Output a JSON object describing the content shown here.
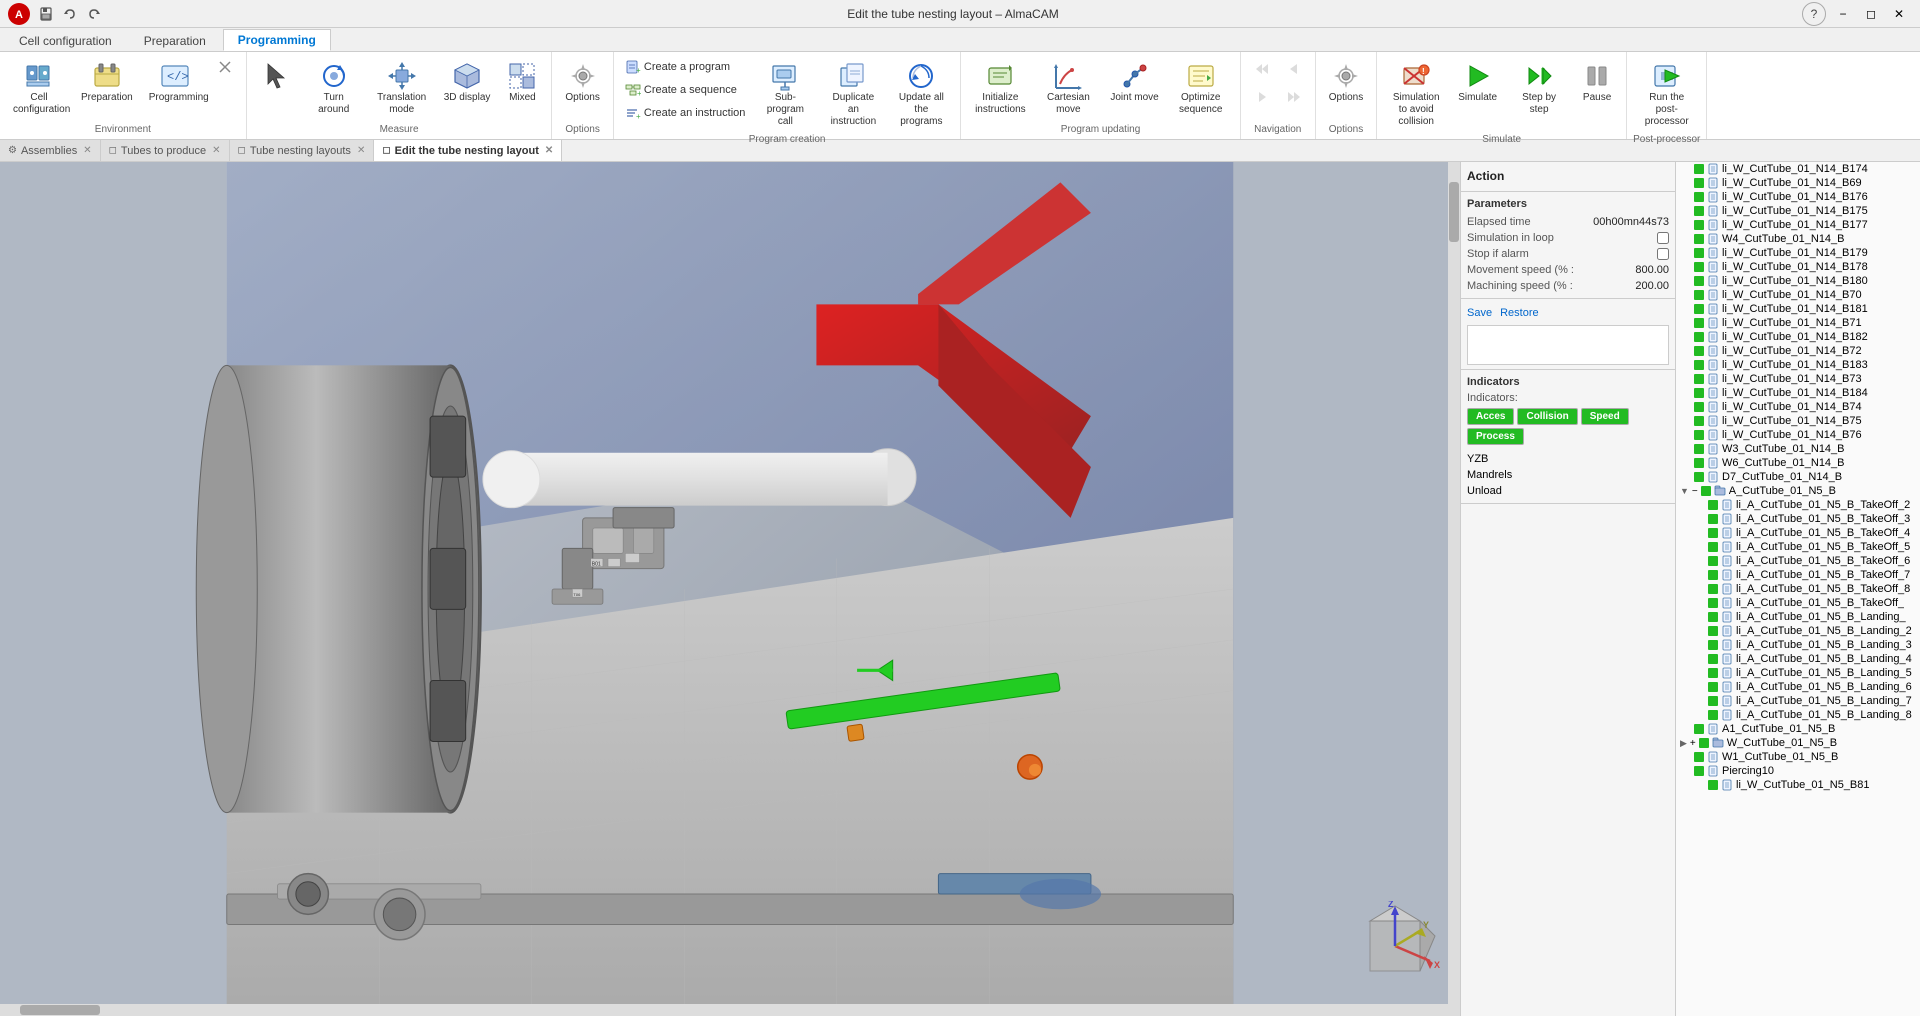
{
  "titlebar": {
    "title": "Edit the tube nesting layout – AlmaCAM",
    "logo_text": "A",
    "quick_actions": [
      "save",
      "undo",
      "redo"
    ],
    "win_buttons": [
      "minimize",
      "restore",
      "close"
    ]
  },
  "ribbon_tabs": [
    {
      "label": "Cell configuration",
      "active": false
    },
    {
      "label": "Preparation",
      "active": false
    },
    {
      "label": "Programming",
      "active": true
    }
  ],
  "ribbon_groups": [
    {
      "id": "environment",
      "label": "Environment",
      "buttons": [
        {
          "id": "cell-config",
          "label": "Cell configuration",
          "icon": "cell"
        },
        {
          "id": "preparation",
          "label": "Preparation",
          "icon": "prep"
        },
        {
          "id": "programming",
          "label": "Programming",
          "icon": "prog"
        }
      ]
    },
    {
      "id": "measure",
      "label": "Measure",
      "buttons": [
        {
          "id": "measure-cursor",
          "label": "",
          "icon": "cursor"
        },
        {
          "id": "turn-around",
          "label": "Turn around",
          "icon": "rotate"
        },
        {
          "id": "translation",
          "label": "Translation mode",
          "icon": "translate"
        },
        {
          "id": "3d-display",
          "label": "3D display",
          "icon": "3d"
        },
        {
          "id": "mixed",
          "label": "Mixed",
          "icon": "mixed"
        }
      ]
    },
    {
      "id": "options-left",
      "label": "Options",
      "buttons": [
        {
          "id": "options",
          "label": "Options",
          "icon": "options"
        }
      ]
    },
    {
      "id": "program-creation",
      "label": "Program creation",
      "buttons": [
        {
          "id": "create-program",
          "label": "Create a program",
          "icon": "create-prog",
          "small": true
        },
        {
          "id": "create-sequence",
          "label": "Create a sequence",
          "icon": "create-seq",
          "small": true
        },
        {
          "id": "create-instruction",
          "label": "Create an instruction",
          "icon": "create-instr",
          "small": true
        },
        {
          "id": "sub-program",
          "label": "Sub-program call",
          "icon": "sub-prog"
        },
        {
          "id": "duplicate",
          "label": "Duplicate an instruction",
          "icon": "duplicate"
        },
        {
          "id": "update-all",
          "label": "Update all the programs",
          "icon": "update"
        }
      ]
    },
    {
      "id": "program-updating",
      "label": "Program updating",
      "buttons": [
        {
          "id": "initialize",
          "label": "Initialize instructions",
          "icon": "init"
        },
        {
          "id": "cartesian-move",
          "label": "Cartesian move",
          "icon": "cart-move"
        },
        {
          "id": "joint-move",
          "label": "Joint move",
          "icon": "joint-move"
        },
        {
          "id": "optimize",
          "label": "Optimize sequence",
          "icon": "optimize"
        }
      ]
    },
    {
      "id": "navigation",
      "label": "Navigation",
      "buttons": [
        {
          "id": "nav-prev-prev",
          "label": "",
          "icon": "nav-prev-prev"
        },
        {
          "id": "nav-prev",
          "label": "",
          "icon": "nav-prev"
        },
        {
          "id": "nav-next",
          "label": "",
          "icon": "nav-next"
        },
        {
          "id": "nav-next-next",
          "label": "",
          "icon": "nav-next-next"
        }
      ]
    },
    {
      "id": "options-right",
      "label": "Options",
      "buttons": [
        {
          "id": "options2",
          "label": "Options",
          "icon": "options2"
        }
      ]
    },
    {
      "id": "simulate-group",
      "label": "Simulate",
      "buttons": [
        {
          "id": "sim-avoid",
          "label": "Simulation to avoid collision",
          "icon": "sim-avoid"
        },
        {
          "id": "simulate",
          "label": "Simulate",
          "icon": "simulate"
        },
        {
          "id": "step-by-step",
          "label": "Step by step",
          "icon": "step"
        },
        {
          "id": "pause",
          "label": "Pause",
          "icon": "pause"
        }
      ]
    },
    {
      "id": "post-processor",
      "label": "Post-processor",
      "buttons": [
        {
          "id": "run-post",
          "label": "Run the post-processor",
          "icon": "run-post"
        }
      ]
    }
  ],
  "doc_tabs": [
    {
      "label": "Assemblies",
      "icon": "assembly",
      "active": false,
      "closable": true
    },
    {
      "label": "Tubes to produce",
      "icon": "tubes",
      "active": false,
      "closable": true
    },
    {
      "label": "Tube nesting layouts",
      "icon": "layouts",
      "active": false,
      "closable": true
    },
    {
      "label": "Edit the tube nesting layout",
      "icon": "edit",
      "active": true,
      "closable": true
    }
  ],
  "action_panel": {
    "title": "Action",
    "parameters": {
      "title": "Parameters",
      "rows": [
        {
          "label": "Elapsed time",
          "value": "00h00mn44s73"
        },
        {
          "label": "Simulation in loop",
          "value": "",
          "checkbox": true,
          "checked": false
        },
        {
          "label": "Stop if alarm",
          "value": "",
          "checkbox": true,
          "checked": false
        },
        {
          "label": "Movement speed (% :",
          "value": "800.00"
        },
        {
          "label": "Machining speed (% :",
          "value": "200.00"
        }
      ]
    },
    "save_label": "Save",
    "restore_label": "Restore",
    "indicators": {
      "title": "Indicators",
      "label": "Indicators:",
      "buttons": [
        {
          "label": "Acces",
          "class": "ind-access"
        },
        {
          "label": "Collision",
          "class": "ind-collision"
        },
        {
          "label": "Speed",
          "class": "ind-speed"
        },
        {
          "label": "Process",
          "class": "ind-process"
        }
      ],
      "rows": [
        {
          "label": "YZB",
          "value": ""
        },
        {
          "label": "Mandrels",
          "value": ""
        },
        {
          "label": "Unload",
          "value": ""
        }
      ]
    }
  },
  "tree_items": [
    {
      "label": "li_W_CutTube_01_N14_B174",
      "status": "green",
      "indent": 1
    },
    {
      "label": "li_W_CutTube_01_N14_B69",
      "status": "green",
      "indent": 1
    },
    {
      "label": "li_W_CutTube_01_N14_B176",
      "status": "green",
      "indent": 1
    },
    {
      "label": "li_W_CutTube_01_N14_B175",
      "status": "green",
      "indent": 1
    },
    {
      "label": "li_W_CutTube_01_N14_B177",
      "status": "green",
      "indent": 1
    },
    {
      "label": "W4_CutTube_01_N14_B",
      "status": "green",
      "indent": 1
    },
    {
      "label": "li_W_CutTube_01_N14_B179",
      "status": "green",
      "indent": 1
    },
    {
      "label": "li_W_CutTube_01_N14_B178",
      "status": "green",
      "indent": 1
    },
    {
      "label": "li_W_CutTube_01_N14_B180",
      "status": "green",
      "indent": 1
    },
    {
      "label": "li_W_CutTube_01_N14_B70",
      "status": "green",
      "indent": 1
    },
    {
      "label": "li_W_CutTube_01_N14_B181",
      "status": "green",
      "indent": 1
    },
    {
      "label": "li_W_CutTube_01_N14_B71",
      "status": "green",
      "indent": 1
    },
    {
      "label": "li_W_CutTube_01_N14_B182",
      "status": "green",
      "indent": 1
    },
    {
      "label": "li_W_CutTube_01_N14_B72",
      "status": "green",
      "indent": 1
    },
    {
      "label": "li_W_CutTube_01_N14_B183",
      "status": "green",
      "indent": 1
    },
    {
      "label": "li_W_CutTube_01_N14_B73",
      "status": "green",
      "indent": 1
    },
    {
      "label": "li_W_CutTube_01_N14_B184",
      "status": "green",
      "indent": 1
    },
    {
      "label": "li_W_CutTube_01_N14_B74",
      "status": "green",
      "indent": 1
    },
    {
      "label": "li_W_CutTube_01_N14_B75",
      "status": "green",
      "indent": 1
    },
    {
      "label": "li_W_CutTube_01_N14_B76",
      "status": "green",
      "indent": 1
    },
    {
      "label": "W3_CutTube_01_N14_B",
      "status": "green",
      "indent": 1
    },
    {
      "label": "W6_CutTube_01_N14_B",
      "status": "green",
      "indent": 1
    },
    {
      "label": "D7_CutTube_01_N14_B",
      "status": "green",
      "indent": 1
    },
    {
      "label": "A_CutTube_01_N5_B",
      "status": "green",
      "indent": 0,
      "group": true,
      "expanded": true
    },
    {
      "label": "li_A_CutTube_01_N5_B_TakeOff_2",
      "status": "green",
      "indent": 2
    },
    {
      "label": "li_A_CutTube_01_N5_B_TakeOff_3",
      "status": "green",
      "indent": 2
    },
    {
      "label": "li_A_CutTube_01_N5_B_TakeOff_4",
      "status": "green",
      "indent": 2
    },
    {
      "label": "li_A_CutTube_01_N5_B_TakeOff_5",
      "status": "green",
      "indent": 2
    },
    {
      "label": "li_A_CutTube_01_N5_B_TakeOff_6",
      "status": "green",
      "indent": 2
    },
    {
      "label": "li_A_CutTube_01_N5_B_TakeOff_7",
      "status": "green",
      "indent": 2
    },
    {
      "label": "li_A_CutTube_01_N5_B_TakeOff_8",
      "status": "green",
      "indent": 2
    },
    {
      "label": "li_A_CutTube_01_N5_B_TakeOff_",
      "status": "green",
      "indent": 2
    },
    {
      "label": "li_A_CutTube_01_N5_B_Landing_",
      "status": "green",
      "indent": 2
    },
    {
      "label": "li_A_CutTube_01_N5_B_Landing_2",
      "status": "green",
      "indent": 2
    },
    {
      "label": "li_A_CutTube_01_N5_B_Landing_3",
      "status": "green",
      "indent": 2
    },
    {
      "label": "li_A_CutTube_01_N5_B_Landing_4",
      "status": "green",
      "indent": 2
    },
    {
      "label": "li_A_CutTube_01_N5_B_Landing_5",
      "status": "green",
      "indent": 2
    },
    {
      "label": "li_A_CutTube_01_N5_B_Landing_6",
      "status": "green",
      "indent": 2
    },
    {
      "label": "li_A_CutTube_01_N5_B_Landing_7",
      "status": "green",
      "indent": 2
    },
    {
      "label": "li_A_CutTube_01_N5_B_Landing_8",
      "status": "green",
      "indent": 2
    },
    {
      "label": "A1_CutTube_01_N5_B",
      "status": "green",
      "indent": 1
    },
    {
      "label": "W_CutTube_01_N5_B",
      "status": "green",
      "indent": 0,
      "group": true,
      "expanded": false
    },
    {
      "label": "W1_CutTube_01_N5_B",
      "status": "green",
      "indent": 1
    },
    {
      "label": "Piercing10",
      "status": "green",
      "indent": 1
    },
    {
      "label": "li_W_CutTube_01_N5_B81",
      "status": "green",
      "indent": 2
    }
  ],
  "colors": {
    "accent_blue": "#0078d4",
    "green_status": "#22bb22",
    "ribbon_bg": "#ffffff",
    "tab_active_bg": "#ffffff"
  }
}
